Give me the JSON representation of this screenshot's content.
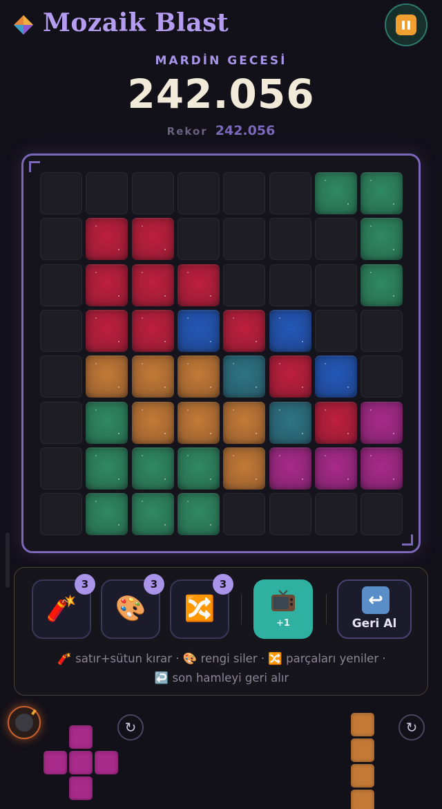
{
  "header": {
    "title": "Mozaik Blast",
    "logo_icon": "diamond-logo-icon",
    "pause_icon": "pause-icon"
  },
  "level": {
    "name": "MARDİN GECESİ"
  },
  "score": {
    "current": "242.056",
    "record_label": "Rekor",
    "record_value": "242.056"
  },
  "colors": {
    "green": "#2f8a62",
    "red": "#bf1f3c",
    "blue": "#2358b8",
    "orange": "#c47a36",
    "teal": "#2e7484",
    "magenta": "#a82a8a",
    "empty": "#1e1d23"
  },
  "board": {
    "rows": 8,
    "cols": 8,
    "grid": [
      [
        ".",
        ".",
        ".",
        ".",
        ".",
        ".",
        "G",
        "G"
      ],
      [
        ".",
        "R",
        "R",
        ".",
        ".",
        ".",
        ".",
        "G"
      ],
      [
        ".",
        "R",
        "R",
        "R",
        ".",
        ".",
        ".",
        "G"
      ],
      [
        ".",
        "R",
        "R",
        "B",
        "R",
        "B",
        ".",
        "."
      ],
      [
        ".",
        "O",
        "O",
        "O",
        "T",
        "R",
        "B",
        "."
      ],
      [
        ".",
        "G",
        "O",
        "O",
        "O",
        "T",
        "R",
        "M"
      ],
      [
        ".",
        "G",
        "G",
        "G",
        "O",
        "M",
        "M",
        "M"
      ],
      [
        ".",
        "G",
        "G",
        "G",
        ".",
        ".",
        ".",
        "."
      ]
    ]
  },
  "tools": [
    {
      "name": "dynamite",
      "emoji": "🧨",
      "count": "3"
    },
    {
      "name": "palette",
      "emoji": "🎨",
      "count": "3"
    },
    {
      "name": "shuffle",
      "emoji": "🔀",
      "count": "3"
    }
  ],
  "ad_button": {
    "label": "+1",
    "icon": "tv-icon"
  },
  "undo_button": {
    "label": "Geri Al",
    "icon": "undo-arrow-icon"
  },
  "legend": {
    "line1": "🧨 satır+sütun kırar · 🎨 rengi siler · 🔀 parçaları yeniler ·",
    "line2": "↩️ son hamleyi geri alır"
  },
  "pieces": [
    {
      "name": "plus-piece",
      "color": "magenta",
      "cells": [
        [
          0,
          1
        ],
        [
          1,
          0
        ],
        [
          1,
          1
        ],
        [
          1,
          2
        ],
        [
          2,
          1
        ]
      ]
    },
    {
      "name": "vertical-line-piece",
      "color": "orange",
      "cells": [
        [
          0,
          0
        ],
        [
          1,
          0
        ],
        [
          2,
          0
        ],
        [
          3,
          0
        ]
      ]
    }
  ],
  "controls": {
    "rotate_symbol": "↻",
    "bomb_icon": "bomb-icon"
  }
}
